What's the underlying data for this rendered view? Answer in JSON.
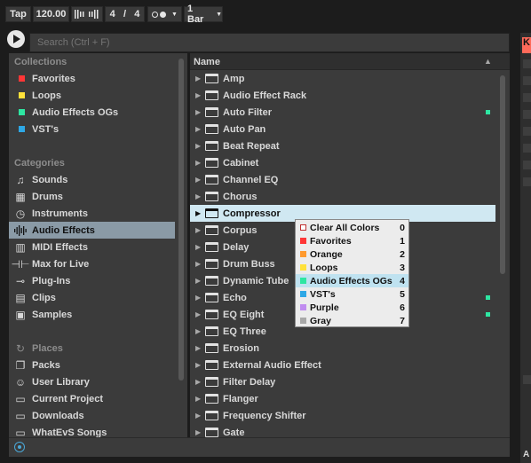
{
  "transport": {
    "tap": "Tap",
    "tempo": "120.00",
    "time_sig_num": "4",
    "time_sig_slash": "/",
    "time_sig_den": "4",
    "quantize": "1 Bar"
  },
  "search": {
    "placeholder": "Search (Ctrl + F)"
  },
  "sidebar": {
    "collections_header": "Collections",
    "collections": [
      {
        "label": "Favorites",
        "color": "#ff3636"
      },
      {
        "label": "Loops",
        "color": "#ffe13a"
      },
      {
        "label": "Audio Effects OGs",
        "color": "#2ee6a2"
      },
      {
        "label": "VST's",
        "color": "#2ea8e6"
      }
    ],
    "categories_header": "Categories",
    "categories": [
      {
        "label": "Sounds",
        "icon": "music-note-icon"
      },
      {
        "label": "Drums",
        "icon": "drums-grid-icon"
      },
      {
        "label": "Instruments",
        "icon": "clock-icon"
      },
      {
        "label": "Audio Effects",
        "icon": "waveform-icon"
      },
      {
        "label": "MIDI Effects",
        "icon": "midi-keys-icon"
      },
      {
        "label": "Max for Live",
        "icon": "max-icon"
      },
      {
        "label": "Plug-Ins",
        "icon": "plug-icon"
      },
      {
        "label": "Clips",
        "icon": "clip-icon"
      },
      {
        "label": "Samples",
        "icon": "sample-icon"
      }
    ],
    "places_header": "Places",
    "places": [
      {
        "label": "Packs",
        "icon": "packs-icon"
      },
      {
        "label": "User Library",
        "icon": "user-icon"
      },
      {
        "label": "Current Project",
        "icon": "project-icon"
      },
      {
        "label": "Downloads",
        "icon": "folder-icon"
      },
      {
        "label": "WhatEvS Songs",
        "icon": "folder-icon"
      }
    ]
  },
  "content": {
    "column_name": "Name",
    "items": [
      {
        "label": "Amp",
        "tagged": false
      },
      {
        "label": "Audio Effect Rack",
        "tagged": false
      },
      {
        "label": "Auto Filter",
        "tagged": true
      },
      {
        "label": "Auto Pan",
        "tagged": false
      },
      {
        "label": "Beat Repeat",
        "tagged": false
      },
      {
        "label": "Cabinet",
        "tagged": false
      },
      {
        "label": "Channel EQ",
        "tagged": false
      },
      {
        "label": "Chorus",
        "tagged": false
      },
      {
        "label": "Compressor",
        "tagged": false,
        "selected": true
      },
      {
        "label": "Corpus",
        "tagged": false
      },
      {
        "label": "Delay",
        "tagged": false
      },
      {
        "label": "Drum Buss",
        "tagged": false
      },
      {
        "label": "Dynamic Tube",
        "tagged": false
      },
      {
        "label": "Echo",
        "tagged": true
      },
      {
        "label": "EQ Eight",
        "tagged": true
      },
      {
        "label": "EQ Three",
        "tagged": false
      },
      {
        "label": "Erosion",
        "tagged": false
      },
      {
        "label": "External Audio Effect",
        "tagged": false
      },
      {
        "label": "Filter Delay",
        "tagged": false
      },
      {
        "label": "Flanger",
        "tagged": false
      },
      {
        "label": "Frequency Shifter",
        "tagged": false
      },
      {
        "label": "Gate",
        "tagged": false
      }
    ]
  },
  "context_menu": {
    "items": [
      {
        "label": "Clear All Colors",
        "key": "0",
        "color": "#ffffff"
      },
      {
        "label": "Favorites",
        "key": "1",
        "color": "#ff3636"
      },
      {
        "label": "Orange",
        "key": "2",
        "color": "#ff9a2e"
      },
      {
        "label": "Loops",
        "key": "3",
        "color": "#ffe13a"
      },
      {
        "label": "Audio Effects OGs",
        "key": "4",
        "color": "#2ee6a2",
        "highlighted": true
      },
      {
        "label": "VST's",
        "key": "5",
        "color": "#2ea8e6"
      },
      {
        "label": "Purple",
        "key": "6",
        "color": "#c08cf0"
      },
      {
        "label": "Gray",
        "key": "7",
        "color": "#a8a8a8"
      }
    ]
  },
  "right_strip": {
    "top_letter": "K",
    "bottom_letter": "A"
  },
  "colors": {
    "accent_selected_row": "#d0e8f2",
    "sidebar_selected": "#8a9aa6"
  }
}
